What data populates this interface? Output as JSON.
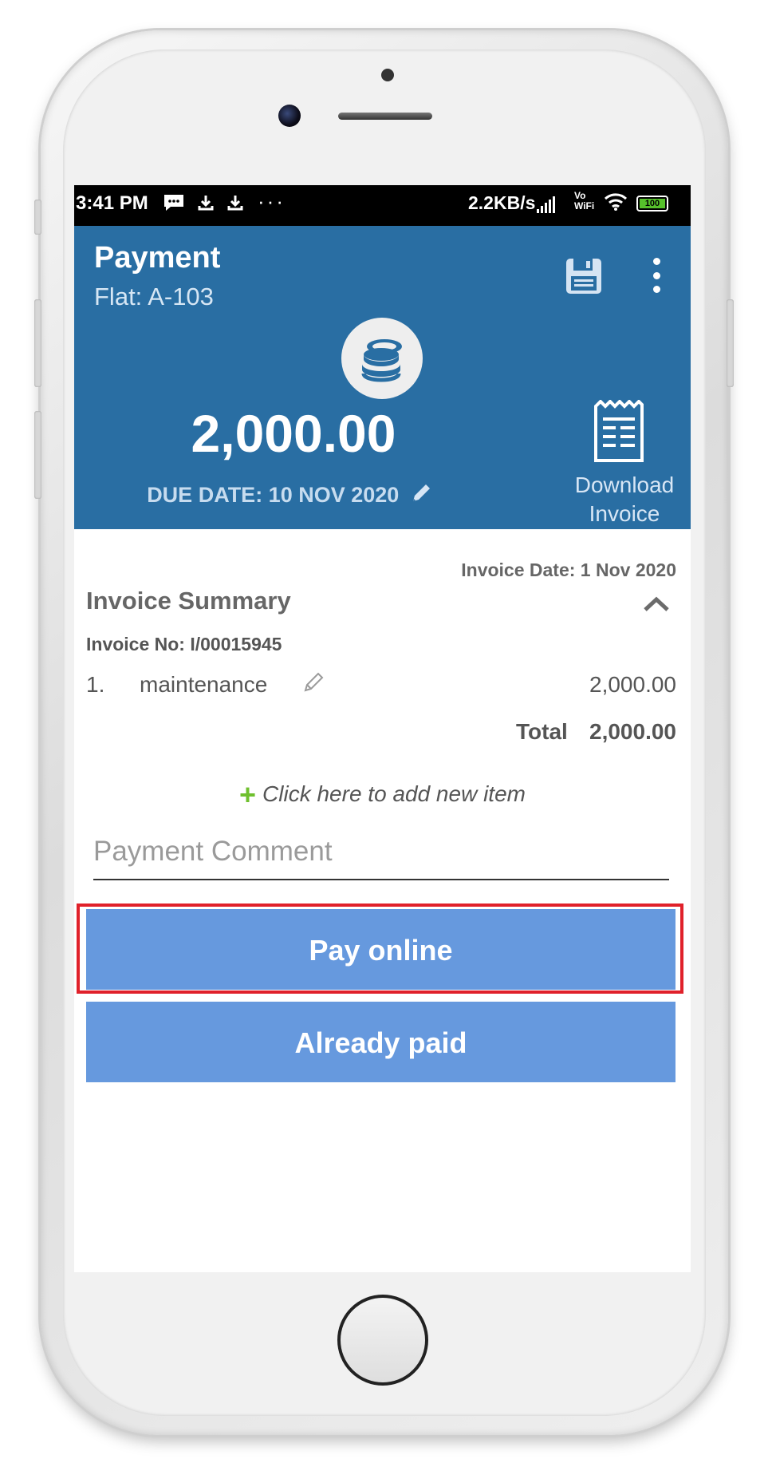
{
  "status_bar": {
    "time": "3:41 PM",
    "net_speed": "2.2KB/s",
    "vowifi_top": "Vo",
    "vowifi_bottom": "WiFi",
    "battery": "100",
    "icons": [
      "message-icon",
      "download-icon",
      "download-icon",
      "more-dots-icon",
      "signal-icon",
      "wifi-icon",
      "battery-icon"
    ]
  },
  "header": {
    "title": "Payment",
    "subtitle": "Flat: A-103",
    "amount": "2,000.00",
    "due_date": "DUE DATE: 10 NOV 2020",
    "download_line1": "Download",
    "download_line2": "Invoice",
    "bg_color": "#296ea3"
  },
  "invoice": {
    "date": "Invoice Date: 1 Nov 2020",
    "summary_title": "Invoice Summary",
    "number": "Invoice No: I/00015945",
    "items": [
      {
        "index": "1.",
        "name": "maintenance",
        "amount": "2,000.00"
      }
    ],
    "total_label": "Total",
    "total_value": "2,000.00",
    "add_item": "Click here to add new item"
  },
  "comment": {
    "placeholder": "Payment Comment",
    "value": ""
  },
  "buttons": {
    "pay_online": "Pay online",
    "already_paid": "Already paid",
    "color": "#6699de",
    "highlight_color": "#e0212a"
  }
}
